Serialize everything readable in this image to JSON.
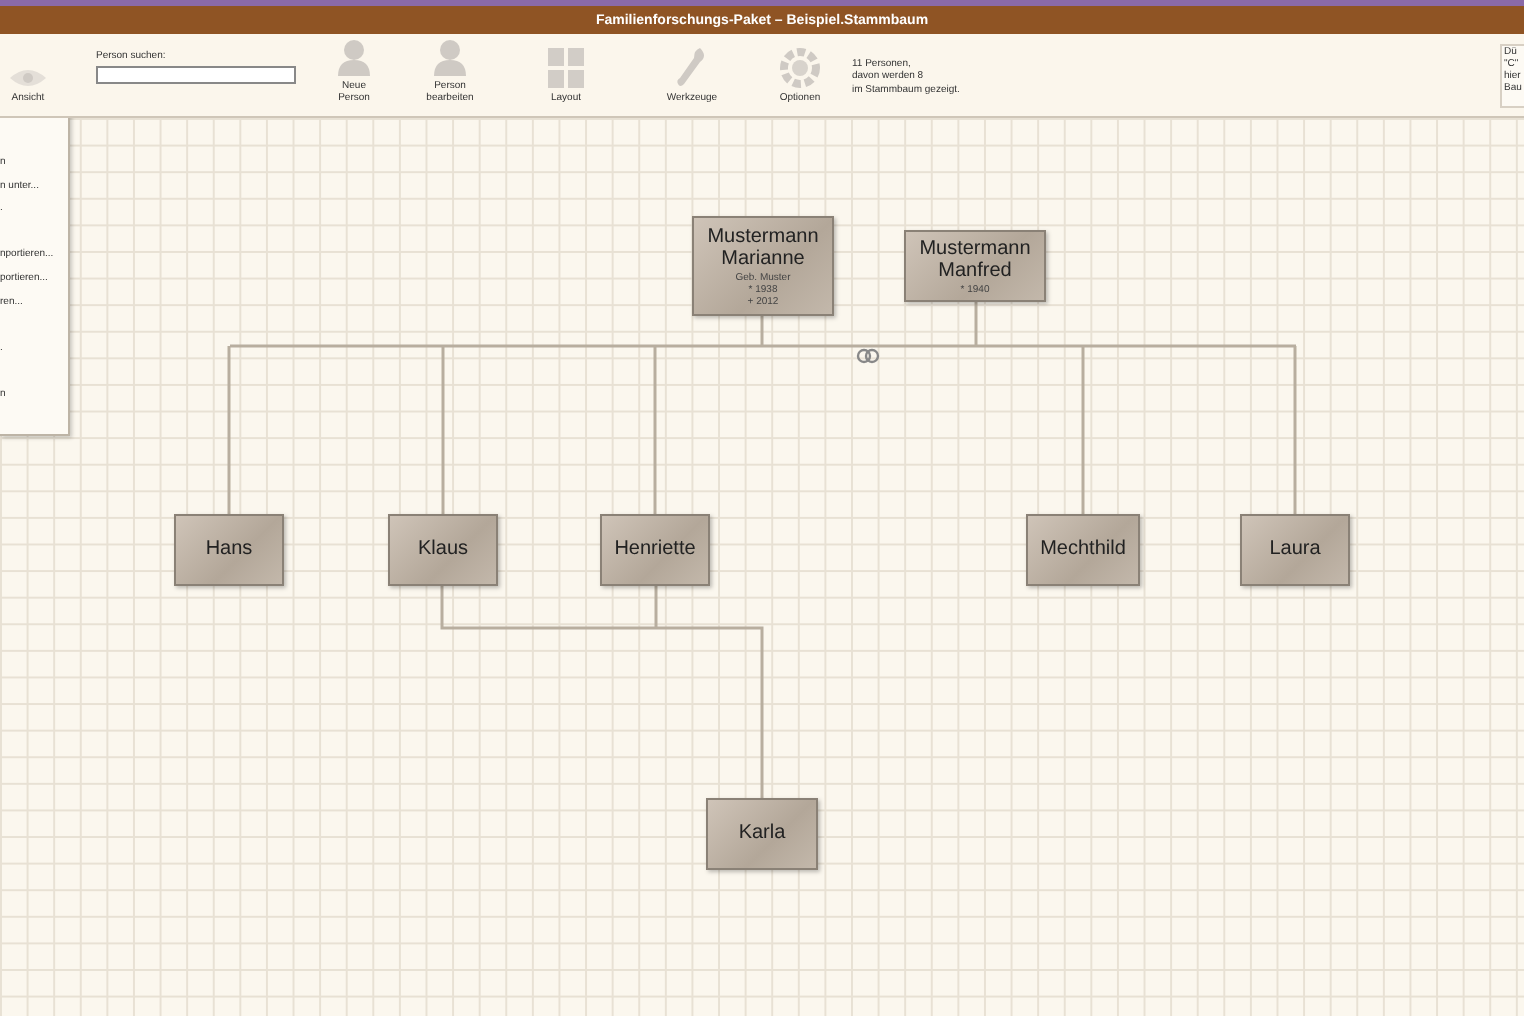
{
  "window": {
    "title": "Familienforschungs-Paket – Beispiel.Stammbaum"
  },
  "toolbar": {
    "view_button": "Ansicht",
    "search": {
      "label": "Person suchen:"
    },
    "buttons": [
      {
        "label": "Neue Person",
        "kind": "person"
      },
      {
        "label": "Person bearbeiten",
        "kind": "person"
      },
      {
        "label": "Layout",
        "kind": "layout"
      },
      {
        "label": "Werkzeuge",
        "kind": "tools"
      },
      {
        "label": "Optionen",
        "kind": "options"
      }
    ],
    "status": [
      "11 Personen,",
      "davon werden 8",
      "im Stammbaum gezeigt."
    ],
    "hint": [
      "Dü",
      "\"C\"",
      "hier",
      "Bau"
    ]
  },
  "menu": {
    "items": [
      "n",
      "n unter...",
      ".",
      "nportieren...",
      "portieren...",
      "ren...",
      ".",
      "n"
    ]
  },
  "tree": {
    "parents": [
      {
        "lines": [
          "Mustermann",
          "Marianne"
        ],
        "details": [
          "Geb. Muster",
          "* 1938",
          "+ 2012"
        ]
      },
      {
        "lines": [
          "Mustermann",
          "Manfred"
        ],
        "details": [
          "* 1940"
        ]
      }
    ],
    "children": [
      {
        "name": "Hans"
      },
      {
        "name": "Klaus"
      },
      {
        "name": "Henriette"
      },
      {
        "name": "Mechthild"
      },
      {
        "name": "Laura"
      }
    ],
    "grandchildren": [
      {
        "name": "Karla"
      }
    ]
  }
}
